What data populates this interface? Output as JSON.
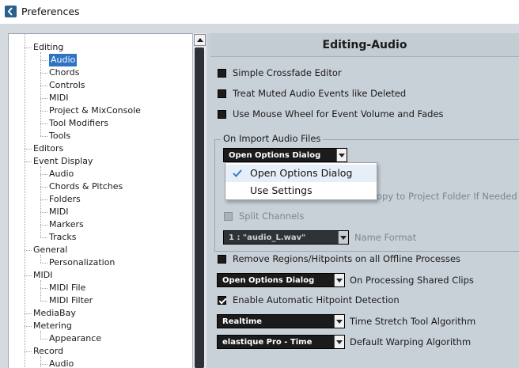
{
  "window": {
    "title": "Preferences"
  },
  "tree": {
    "items": [
      {
        "label": "Editing",
        "level": 1
      },
      {
        "label": "Audio",
        "level": 2,
        "selected": true
      },
      {
        "label": "Chords",
        "level": 2
      },
      {
        "label": "Controls",
        "level": 2
      },
      {
        "label": "MIDI",
        "level": 2
      },
      {
        "label": "Project & MixConsole",
        "level": 2
      },
      {
        "label": "Tool Modifiers",
        "level": 2
      },
      {
        "label": "Tools",
        "level": 2
      },
      {
        "label": "Editors",
        "level": 1
      },
      {
        "label": "Event Display",
        "level": 1
      },
      {
        "label": "Audio",
        "level": 2
      },
      {
        "label": "Chords & Pitches",
        "level": 2
      },
      {
        "label": "Folders",
        "level": 2
      },
      {
        "label": "MIDI",
        "level": 2
      },
      {
        "label": "Markers",
        "level": 2
      },
      {
        "label": "Tracks",
        "level": 2
      },
      {
        "label": "General",
        "level": 1
      },
      {
        "label": "Personalization",
        "level": 2
      },
      {
        "label": "MIDI",
        "level": 1
      },
      {
        "label": "MIDI File",
        "level": 2
      },
      {
        "label": "MIDI Filter",
        "level": 2
      },
      {
        "label": "MediaBay",
        "level": 1
      },
      {
        "label": "Metering",
        "level": 1
      },
      {
        "label": "Appearance",
        "level": 2
      },
      {
        "label": "Record",
        "level": 1
      },
      {
        "label": "Audio",
        "level": 2
      }
    ]
  },
  "content": {
    "title": "Editing-Audio",
    "simple_crossfade": {
      "label": "Simple Crossfade Editor",
      "checked": false
    },
    "treat_muted": {
      "label": "Treat Muted Audio Events like Deleted",
      "checked": false
    },
    "mouse_wheel": {
      "label": "Use Mouse Wheel for Event Volume and Fades",
      "checked": false
    },
    "import_group": {
      "title": "On Import Audio Files",
      "dropdown_value": "Open Options Dialog",
      "popup_options": [
        "Open Options Dialog",
        "Use Settings"
      ],
      "popup_selected": "Open Options Dialog",
      "copy_label_partial": "opy to Project Folder If Needed",
      "split_channels": "Split Channels",
      "name_format_value": "1 : \"audio_L.wav\"",
      "name_format_label": "Name Format"
    },
    "remove_regions": {
      "label": "Remove Regions/Hitpoints on all Offline Processes",
      "checked": false
    },
    "shared_clips": {
      "value": "Open Options Dialog",
      "label": "On Processing Shared Clips"
    },
    "hitpoint_detection": {
      "label": "Enable Automatic Hitpoint Detection",
      "checked": true
    },
    "time_stretch": {
      "value": "Realtime",
      "label": "Time Stretch Tool Algorithm"
    },
    "warping": {
      "value": "elastique Pro - Time",
      "label": "Default Warping Algorithm"
    }
  }
}
